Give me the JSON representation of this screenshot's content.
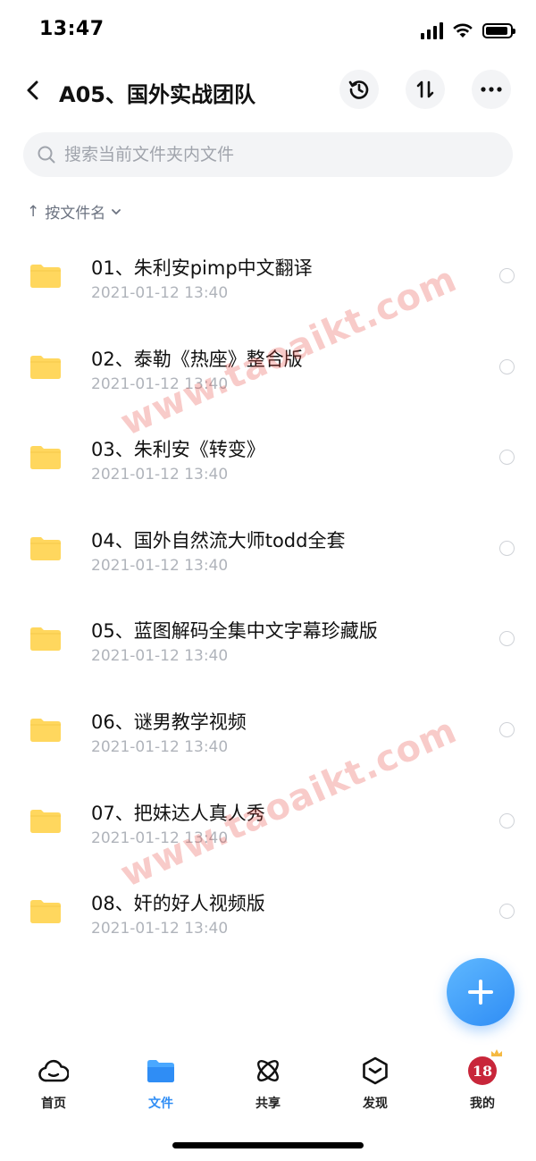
{
  "status_bar": {
    "time": "13:47"
  },
  "nav": {
    "title": "A05、国外实战团队"
  },
  "search": {
    "placeholder": "搜索当前文件夹内文件"
  },
  "sort": {
    "label": "按文件名"
  },
  "files": [
    {
      "name": "01、朱利安pimp中文翻译",
      "date": "2021-01-12 13:40"
    },
    {
      "name": "02、泰勒《热座》整合版",
      "date": "2021-01-12 13:40"
    },
    {
      "name": "03、朱利安《转变》",
      "date": "2021-01-12 13:40"
    },
    {
      "name": "04、国外自然流大师todd全套",
      "date": "2021-01-12 13:40"
    },
    {
      "name": "05、蓝图解码全集中文字幕珍藏版",
      "date": "2021-01-12 13:40"
    },
    {
      "name": "06、谜男教学视频",
      "date": "2021-01-12 13:40"
    },
    {
      "name": "07、把妹达人真人秀",
      "date": "2021-01-12 13:40"
    },
    {
      "name": "08、奸的好人视频版",
      "date": "2021-01-12 13:40"
    }
  ],
  "watermark": {
    "text": "www.taoaikt.com"
  },
  "tabbar": {
    "items": [
      {
        "label": "首页",
        "icon": "cloud-icon"
      },
      {
        "label": "文件",
        "icon": "folder-icon"
      },
      {
        "label": "共享",
        "icon": "atom-icon"
      },
      {
        "label": "发现",
        "icon": "discover-icon"
      },
      {
        "label": "我的",
        "icon": "avatar"
      }
    ],
    "active": "文件"
  },
  "avatar": {
    "text": "18"
  },
  "colors": {
    "accent": "#2f8df5",
    "folder": "#ffd75e",
    "watermark": "#e6463c"
  }
}
